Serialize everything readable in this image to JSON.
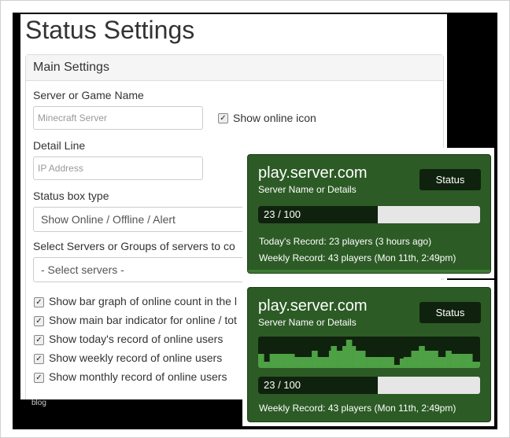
{
  "page": {
    "title": "Status Settings",
    "watermark": "blog"
  },
  "main_settings": {
    "header": "Main Settings",
    "server_name": {
      "label": "Server or Game Name",
      "placeholder": "Minecraft Server"
    },
    "show_online_icon": {
      "label": "Show online icon",
      "checked": true
    },
    "detail_line": {
      "label": "Detail Line",
      "placeholder": "IP Address"
    },
    "status_box_type": {
      "label": "Status box type",
      "selected": "Show Online / Offline / Alert"
    },
    "select_servers": {
      "label": "Select Servers or Groups of servers to co",
      "selected": "- Select servers -"
    },
    "options": [
      {
        "label": "Show bar graph of online count in the l",
        "checked": true
      },
      {
        "label": "Show main bar indicator for online / tot",
        "checked": true
      },
      {
        "label": "Show today's record of online users",
        "checked": true
      },
      {
        "label": "Show weekly record of online users",
        "checked": true
      },
      {
        "label": "Show monthly record of online users",
        "checked": true
      }
    ]
  },
  "widgets": [
    {
      "server": "play.server.com",
      "subtitle": "Server Name or Details",
      "status": "Status",
      "bar_text": "23 / 100",
      "bar_fraction": 0.54,
      "today_record": "Today's Record: 23 players (3 hours ago)",
      "weekly_record": "Weekly Record: 43 players (Mon 11th, 2:49pm)"
    },
    {
      "server": "play.server.com",
      "subtitle": "Server Name or Details",
      "status": "Status",
      "bar_text": "23 / 100",
      "bar_fraction": 0.54,
      "weekly_record": "Weekly Record: 43 players (Mon 11th, 2:49pm)",
      "graph_levels": [
        0.45,
        0.45,
        0.45,
        0.2,
        0.2,
        0.2,
        0.45,
        0.45,
        0.45,
        0.45,
        0.45,
        0.45,
        0.45,
        0.45,
        0.45,
        0.45,
        0.45,
        0.45,
        0.45,
        0.35,
        0.35,
        0.35,
        0.35,
        0.35,
        0.35,
        0.35,
        0.35,
        0.35,
        0.55,
        0.55,
        0.55,
        0.35,
        0.35,
        0.35,
        0.35,
        0.35,
        0.35,
        0.55,
        0.7,
        0.7,
        0.7,
        0.55,
        0.55,
        0.55,
        0.7,
        0.7,
        0.9,
        0.9,
        0.9,
        0.7,
        0.7,
        0.55,
        0.55,
        0.55,
        0.55,
        0.55,
        0.35,
        0.35,
        0.35,
        0.35,
        0.35,
        0.35,
        0.35,
        0.35,
        0.35,
        0.35,
        0.35,
        0.35,
        0.35,
        0.35,
        0.35,
        0.1,
        0.1,
        0.1,
        0.3,
        0.3,
        0.35,
        0.35,
        0.35,
        0.35,
        0.55,
        0.55,
        0.55,
        0.55,
        0.7,
        0.7,
        0.7,
        0.55,
        0.55,
        0.55,
        0.55,
        0.55,
        0.55,
        0.55,
        0.35,
        0.35,
        0.35,
        0.35,
        0.55,
        0.55,
        0.55,
        0.45,
        0.45,
        0.45,
        0.45,
        0.45,
        0.45,
        0.45,
        0.45,
        0.45,
        0.45,
        0.45,
        0.2,
        0.2,
        0.2,
        0.2
      ]
    }
  ]
}
